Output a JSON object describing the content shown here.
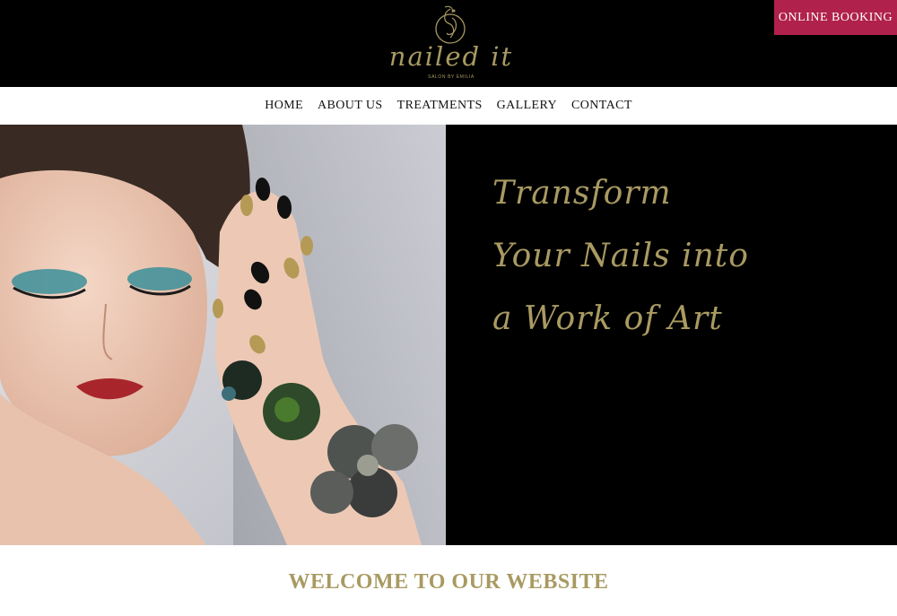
{
  "brand": {
    "logo_text": "nailed it",
    "logo_tagline": "SALON BY EMILIA",
    "accent_color": "#a99a62",
    "booking_color": "#b0214b"
  },
  "header": {
    "booking_label": "ONLINE BOOKING"
  },
  "nav": {
    "items": [
      {
        "label": "HOME"
      },
      {
        "label": "ABOUT US"
      },
      {
        "label": "TREATMENTS"
      },
      {
        "label": "GALLERY"
      },
      {
        "label": "CONTACT"
      }
    ]
  },
  "hero": {
    "image_subject": "woman-with-painted-nails-and-jeweled-bracelet",
    "tagline_lines": [
      "Transform",
      "Your Nails into",
      "a Work of Art"
    ]
  },
  "welcome": {
    "heading": "WELCOME TO OUR WEBSITE"
  }
}
